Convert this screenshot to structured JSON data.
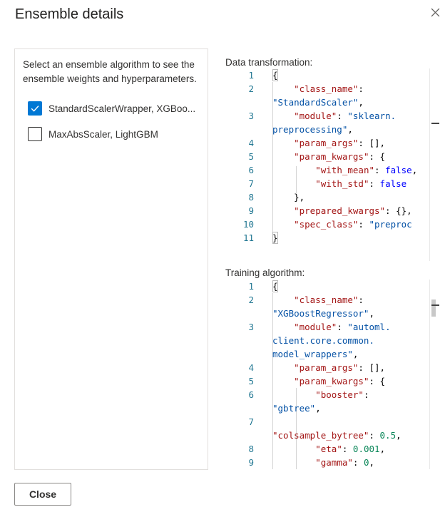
{
  "dialog": {
    "title": "Ensemble details",
    "close_button_label": "Close"
  },
  "left_panel": {
    "instructions": "Select an ensemble algorithm to see the ensemble weights and hyperparameters.",
    "algorithms": [
      {
        "label": "StandardScalerWrapper, XGBoo...",
        "checked": true
      },
      {
        "label": "MaxAbsScaler, LightGBM",
        "checked": false
      }
    ]
  },
  "data_transformation": {
    "label": "Data transformation:",
    "lines": [
      {
        "n": "1",
        "text": "{"
      },
      {
        "n": "2",
        "text": "    \"class_name\": \"StandardScaler\","
      },
      {
        "n": "3",
        "text": "    \"module\": \"sklearn.preprocessing\","
      },
      {
        "n": "4",
        "text": "    \"param_args\": [],"
      },
      {
        "n": "5",
        "text": "    \"param_kwargs\": {"
      },
      {
        "n": "6",
        "text": "        \"with_mean\": false,"
      },
      {
        "n": "7",
        "text": "        \"with_std\": false"
      },
      {
        "n": "8",
        "text": "    },"
      },
      {
        "n": "9",
        "text": "    \"prepared_kwargs\": {},"
      },
      {
        "n": "10",
        "text": "    \"spec_class\": \"preproc"
      },
      {
        "n": "11",
        "text": "}"
      }
    ]
  },
  "training_algorithm": {
    "label": "Training algorithm:",
    "lines": [
      {
        "n": "1",
        "text": "{"
      },
      {
        "n": "2",
        "text": "    \"class_name\": \"XGBoostRegressor\","
      },
      {
        "n": "3",
        "text": "    \"module\": \"automl.client.core.common.model_wrappers\","
      },
      {
        "n": "4",
        "text": "    \"param_args\": [],"
      },
      {
        "n": "5",
        "text": "    \"param_kwargs\": {"
      },
      {
        "n": "6",
        "text": "        \"booster\": \"gbtree\","
      },
      {
        "n": "7",
        "text": "        \"colsample_bytree\": 0.5,"
      },
      {
        "n": "8",
        "text": "        \"eta\": 0.001,"
      },
      {
        "n": "9",
        "text": "        \"gamma\": 0,"
      }
    ]
  },
  "colors": {
    "accent": "#0078d4",
    "json_key": "#a31515",
    "json_string": "#0451a5",
    "json_boolean": "#0000ff",
    "json_number": "#098658",
    "line_number": "#237893"
  },
  "icons": {
    "dialog_close": "close-icon",
    "checkbox_checked": "checkmark-icon"
  }
}
